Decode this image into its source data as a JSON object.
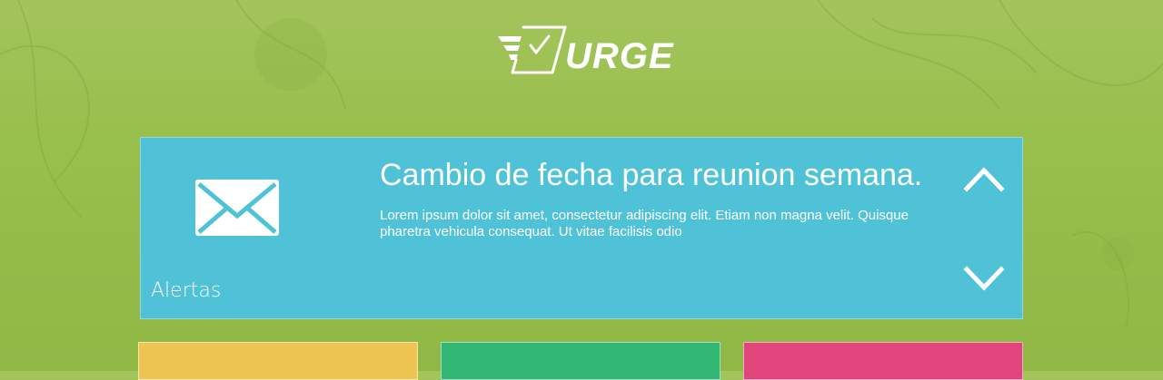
{
  "header": {
    "logo_text": "URGE"
  },
  "alert_panel": {
    "section_label": "Alertas",
    "title": "Cambio de fecha para reunion semana.",
    "body": "Lorem ipsum dolor sit amet, consectetur adipiscing elit. Etiam non magna velit. Quisque pharetra vehicula consequat. Ut vitae facilisis odio",
    "icons": {
      "message": "envelope-icon",
      "previous": "chevron-up-icon",
      "next": "chevron-down-icon"
    }
  },
  "tiles": [
    {
      "name": "tile-yellow",
      "color": "#eec552"
    },
    {
      "name": "tile-green",
      "color": "#33b775"
    },
    {
      "name": "tile-pink",
      "color": "#e0457c"
    }
  ],
  "colors": {
    "background": "#9bc050",
    "panel": "#4fc2d8",
    "text": "#ffffff"
  }
}
